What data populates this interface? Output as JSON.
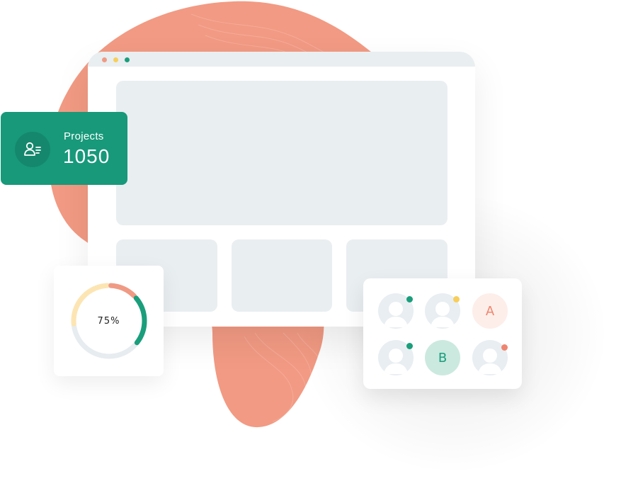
{
  "projects": {
    "label": "Projects",
    "value": "1050",
    "icon": "user-list-icon"
  },
  "progress": {
    "label": "75%",
    "value": 0.75
  },
  "browser": {
    "controls": [
      "close-dot",
      "minimize-dot",
      "maximize-dot"
    ]
  },
  "team": {
    "members": [
      {
        "type": "photo",
        "status_color": "#1a9e7c"
      },
      {
        "type": "photo",
        "status_color": "#f7ce5b"
      },
      {
        "type": "initial",
        "initial": "A"
      },
      {
        "type": "photo",
        "status_color": "#1a9e7c"
      },
      {
        "type": "initial",
        "initial": "B"
      },
      {
        "type": "photo",
        "status_color": "#ef8570"
      }
    ]
  },
  "colors": {
    "accent": "#17997a",
    "blob": "#f29a83",
    "panel": "#e9eef1",
    "ring_orange": "#f09a84",
    "ring_green": "#1a9e7c",
    "ring_yellow": "#fde5b3",
    "ring_track": "#e6ecef"
  }
}
